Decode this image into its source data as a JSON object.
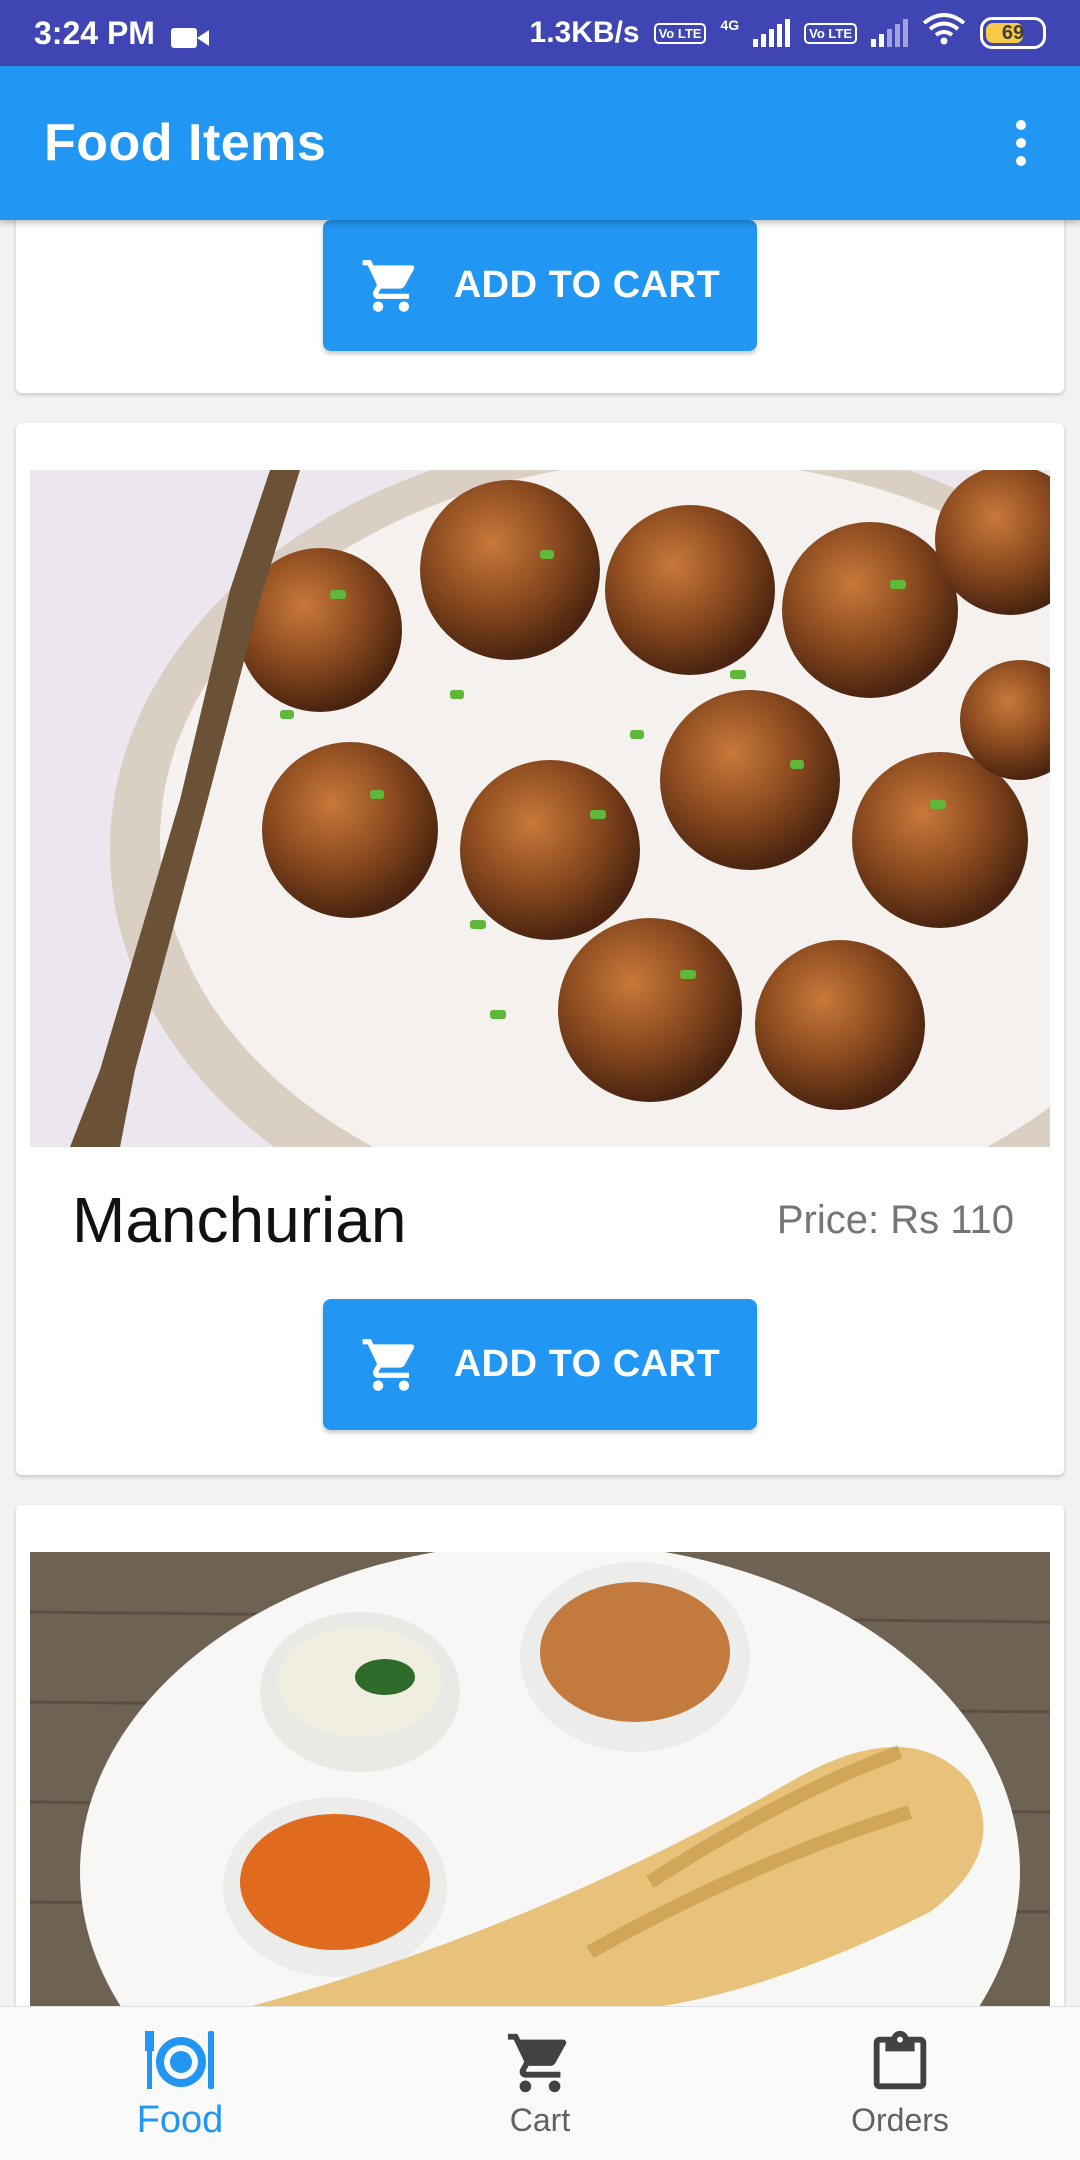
{
  "status_bar": {
    "time": "3:24 PM",
    "net_speed": "1.3KB/s",
    "lte1": "Vo LTE",
    "net_type": "4G",
    "lte2": "Vo LTE",
    "battery": "69"
  },
  "app_bar": {
    "title": "Food Items",
    "menu_icon": "more-vert-icon"
  },
  "items": [
    {
      "button_label": "ADD TO CART"
    },
    {
      "name": "Manchurian",
      "price": "Price: Rs 110",
      "button_label": "ADD TO CART",
      "image": "manchurian-photo"
    },
    {
      "image": "dosa-photo"
    }
  ],
  "bottom_nav": {
    "items": [
      {
        "label": "Food",
        "icon": "restaurant-icon",
        "active": true
      },
      {
        "label": "Cart",
        "icon": "cart-icon",
        "active": false
      },
      {
        "label": "Orders",
        "icon": "clipboard-icon",
        "active": false
      }
    ]
  },
  "colors": {
    "status_bar": "#3f46b4",
    "primary": "#2196f3",
    "background": "#f2f2f2"
  }
}
